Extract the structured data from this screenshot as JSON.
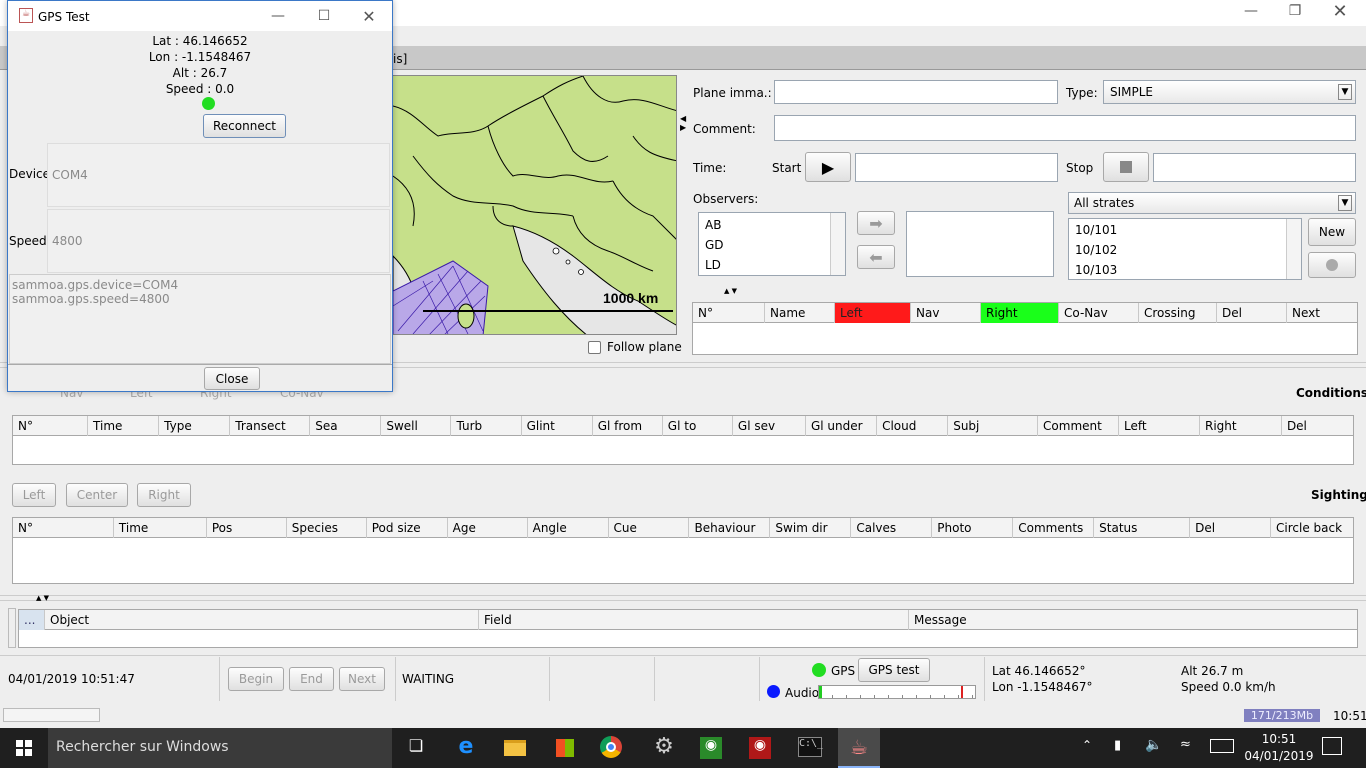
{
  "main_window": {
    "tab_fragment": "is]",
    "plane_label": "Plane imma.:",
    "type_label": "Type:",
    "type_value": "SIMPLE",
    "comment_label": "Comment:",
    "time_label": "Time:",
    "start_label": "Start",
    "stop_label": "Stop",
    "observers_label": "Observers:",
    "observers": [
      "AB",
      "GD",
      "LD"
    ],
    "strata_select": "All strates",
    "strata_items": [
      "10/101",
      "10/102",
      "10/103"
    ],
    "new_button": "New",
    "follow_plane": "Follow plane",
    "map_scale": "1000 km",
    "nav_columns": [
      "N°",
      "Name",
      "Left",
      "Nav",
      "Right",
      "Co-Nav",
      "Crossing",
      "Del",
      "Next"
    ],
    "colors": {
      "left": "#ff1a1a",
      "right": "#1aff1a",
      "map_land": "#c6e08a",
      "map_sea": "#e6e6e6"
    },
    "ghost_row": [
      "Nav",
      "Left",
      "Right",
      "Co-Nav"
    ],
    "conditions_title": "Conditions",
    "conditions_columns": [
      "N°",
      "Time",
      "Type",
      "Transect",
      "Sea",
      "Swell",
      "Turb",
      "Glint",
      "Gl from",
      "Gl to",
      "Gl sev",
      "Gl under",
      "Cloud",
      "Subj",
      "Comment",
      "Left",
      "Right",
      "Del"
    ],
    "side_buttons": [
      "Left",
      "Center",
      "Right"
    ],
    "sighting_title": "Sighting",
    "sighting_columns": [
      "N°",
      "Time",
      "Pos",
      "Species",
      "Pod size",
      "Age",
      "Angle",
      "Cue",
      "Behaviour",
      "Swim dir",
      "Calves",
      "Photo",
      "Comments",
      "Status",
      "Del",
      "Circle back"
    ],
    "log_columns": [
      "...",
      "Object",
      "Field",
      "Message"
    ],
    "status": {
      "datetime": "04/01/2019 10:51:47",
      "begin": "Begin",
      "end": "End",
      "next": "Next",
      "state": "WAITING",
      "gps_label": "GPS",
      "gps_test": "GPS test",
      "audio_label": "Audio",
      "lat": "Lat 46.146652°",
      "lon": "Lon -1.1548467°",
      "alt": "Alt 26.7 m",
      "speed": "Speed 0.0 km/h",
      "memory": "171/213Mb",
      "clock": "10:51"
    }
  },
  "gps_dialog": {
    "title": "GPS Test",
    "lat": "Lat : 46.146652",
    "lon": "Lon : -1.1548467",
    "alt": "Alt : 26.7",
    "speed": "Speed : 0.0",
    "reconnect": "Reconnect",
    "device_label": "Device",
    "device_value": "COM4",
    "speed_label": "Speed",
    "speed_value": "4800",
    "log_lines": [
      "sammoa.gps.device=COM4",
      "sammoa.gps.speed=4800"
    ],
    "close": "Close"
  },
  "taskbar": {
    "search_placeholder": "Rechercher sur Windows",
    "time": "10:51",
    "date": "04/01/2019"
  }
}
